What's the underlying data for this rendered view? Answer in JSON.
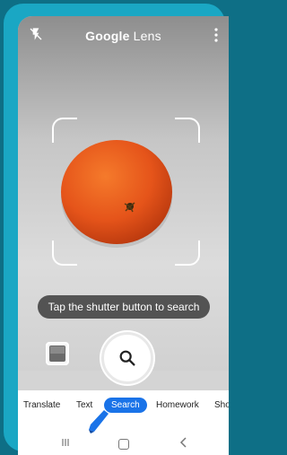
{
  "app": {
    "title_brand": "Google",
    "title_product": "Lens"
  },
  "camera": {
    "hint": "Tap the shutter button to search"
  },
  "tabs": [
    {
      "label": "Translate"
    },
    {
      "label": "Text"
    },
    {
      "label": "Search",
      "active": true
    },
    {
      "label": "Homework"
    },
    {
      "label": "Sho"
    }
  ],
  "colors": {
    "accent": "#1a73e8",
    "device": "#1aa7c4",
    "background": "#0e6f86"
  },
  "icons": {
    "flash": "flash-off-icon",
    "menu": "more-vert-icon",
    "gallery": "gallery-thumbnail-icon",
    "shutter": "search-icon"
  }
}
